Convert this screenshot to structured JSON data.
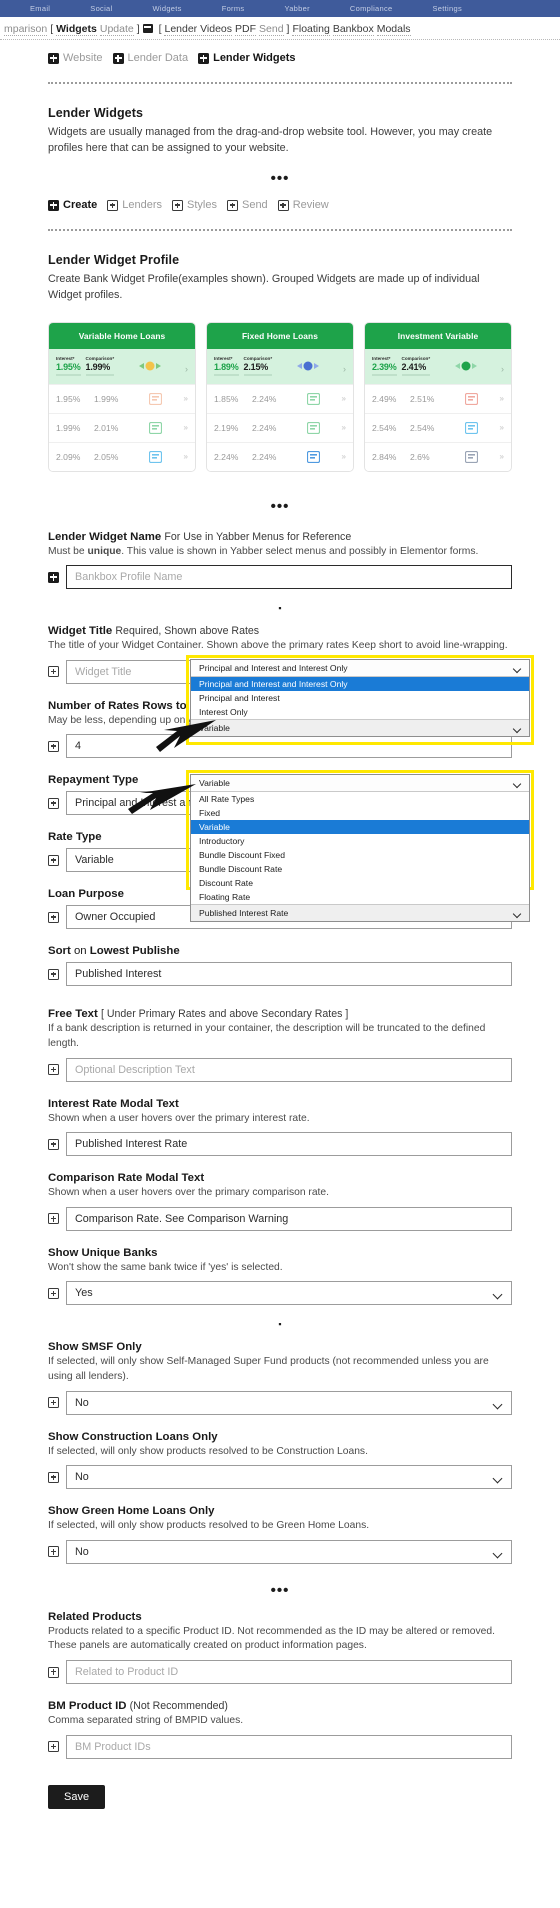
{
  "adminbar": {
    "items": [
      "Email",
      "Social",
      "Widgets",
      "Forms",
      "Yabber",
      "Compliance",
      "Settings"
    ]
  },
  "navstrip": {
    "items": [
      {
        "text": "mparison",
        "style": "dim"
      },
      {
        "text": "[",
        "style": "dark"
      },
      {
        "text": "Widgets",
        "style": "strong"
      },
      {
        "text": "Update",
        "style": "dim"
      },
      {
        "text": "]",
        "style": "dark"
      },
      {
        "text": "icon",
        "style": "icon"
      },
      {
        "text": "[",
        "style": "dark"
      },
      {
        "text": "Lender Videos",
        "style": "dark"
      },
      {
        "text": "PDF",
        "style": "dark"
      },
      {
        "text": "Send",
        "style": "dim"
      },
      {
        "text": "]",
        "style": "dark"
      },
      {
        "text": "Floating",
        "style": "dark"
      },
      {
        "text": "Bankbox",
        "style": "dark"
      },
      {
        "text": "Modals",
        "style": "dark"
      }
    ]
  },
  "breadcrumb_tabs": [
    {
      "label": "Website",
      "active": false
    },
    {
      "label": "Lender Data",
      "active": false
    },
    {
      "label": "Lender Widgets",
      "active": true
    }
  ],
  "intro": {
    "title": "Lender Widgets",
    "description": "Widgets are usually managed from the drag-and-drop website tool. However, you may create profiles here that can be assigned to your website.",
    "ellipsis": "•••"
  },
  "subtabs": [
    {
      "label": "Create",
      "active": true
    },
    {
      "label": "Lenders",
      "active": false
    },
    {
      "label": "Styles",
      "active": false
    },
    {
      "label": "Send",
      "active": false
    },
    {
      "label": "Review",
      "active": false
    }
  ],
  "profile": {
    "title": "Lender Widget Profile",
    "description": "Create Bank Widget Profile(examples shown). Grouped Widgets are made up of individual Widget profiles."
  },
  "widget_cards": [
    {
      "title": "Variable Home Loans",
      "col1_label": "Interest*",
      "col2_label": "Comparison*",
      "primary": {
        "interest": "1.95%",
        "comparison": "1.99%"
      },
      "rows": [
        {
          "interest": "1.95%",
          "comparison": "1.99%"
        },
        {
          "interest": "1.99%",
          "comparison": "2.01%"
        },
        {
          "interest": "2.09%",
          "comparison": "2.05%"
        }
      ]
    },
    {
      "title": "Fixed Home Loans",
      "col1_label": "Interest*",
      "col2_label": "Comparison*",
      "primary": {
        "interest": "1.89%",
        "comparison": "2.15%"
      },
      "rows": [
        {
          "interest": "1.85%",
          "comparison": "2.24%"
        },
        {
          "interest": "2.19%",
          "comparison": "2.24%"
        },
        {
          "interest": "2.24%",
          "comparison": "2.24%"
        }
      ]
    },
    {
      "title": "Investment Variable",
      "col1_label": "Interest*",
      "col2_label": "Comparison*",
      "primary": {
        "interest": "2.39%",
        "comparison": "2.41%"
      },
      "rows": [
        {
          "interest": "2.49%",
          "comparison": "2.51%"
        },
        {
          "interest": "2.54%",
          "comparison": "2.54%"
        },
        {
          "interest": "2.84%",
          "comparison": "2.6%"
        }
      ]
    }
  ],
  "fields": {
    "lender_widget_name": {
      "label_bold": "Lender Widget Name",
      "label_light": "For Use in Yabber Menus for Reference",
      "help_a": "Must be ",
      "help_b": "unique",
      "help_c": ". This value is shown in Yabber select menus and possibly in Elementor forms.",
      "placeholder": "Bankbox Profile Name"
    },
    "widget_title": {
      "label_bold": "Widget Title",
      "label_light": "Required, Shown above Rates",
      "help": "The title of your Widget Container. Shown above the primary rates Keep short to avoid line-wrapping.",
      "placeholder": "Widget Title"
    },
    "rates_rows": {
      "label": "Number of Rates Rows to Show",
      "help": "May be less, depending up  only a few banks are used.",
      "value": "4"
    },
    "repayment_type": {
      "label": "Repayment Type",
      "value": "Principal and Interest and Interest Only"
    },
    "rate_type": {
      "label": "Rate Type",
      "value": "Variable"
    },
    "loan_purpose": {
      "label": "Loan Purpose",
      "value": "Owner Occupied"
    },
    "sort_on": {
      "label_a": "Sort",
      "label_b": " on ",
      "label_c": "Lowest Publishe",
      "value": "Published Interest "
    },
    "free_text": {
      "label_bold": "Free Text",
      "label_light": "[ Under Primary Rates and above Secondary Rates ]",
      "help": "If a bank description is returned in your container, the description will be truncated to the defined length.",
      "placeholder": "Optional Description Text"
    },
    "interest_modal": {
      "label": "Interest Rate Modal Text",
      "help": "Shown when a user hovers over the primary interest rate.",
      "value": "Published Interest Rate"
    },
    "comparison_modal": {
      "label": "Comparison Rate Modal Text",
      "help": "Shown when a user hovers over the primary comparison rate.",
      "value": "Comparison Rate. See Comparison Warning"
    },
    "unique_banks": {
      "label": "Show Unique Banks",
      "help": "Won't show the same bank twice if 'yes' is selected.",
      "value": "Yes"
    },
    "smsf_only": {
      "label": "Show SMSF Only",
      "help": "If selected, will only show Self-Managed Super Fund products (not recommended unless you are using all lenders).",
      "value": "No"
    },
    "construction_only": {
      "label": "Show Construction Loans Only",
      "help": "If selected, will only show products resolved to be Construction Loans.",
      "value": "No"
    },
    "green_only": {
      "label": "Show Green Home Loans Only",
      "help": "If selected, will only show products resolved to be Green Home Loans.",
      "value": "No"
    },
    "related_products": {
      "label": "Related Products",
      "help": "Products related to a specific Product ID. Not recommended as the ID may be altered or removed. These panels are automatically created on product information pages.",
      "placeholder": "Related to Product ID"
    },
    "bm_product_id": {
      "label_bold": "BM Product ID",
      "label_light": "(Not Recommended)",
      "help": "Comma separated string of BMPID values.",
      "placeholder": "BM Product IDs"
    }
  },
  "open_dropdown_repayment": {
    "selected": "Principal and Interest and Interest Only",
    "options": [
      "Principal and Interest and Interest Only",
      "Principal and Interest",
      "Interest Only"
    ],
    "highlighted_index": 0,
    "footer": "Variable"
  },
  "open_dropdown_rate_type": {
    "selected": "Variable",
    "options": [
      "All Rate Types",
      "Fixed",
      "Variable",
      "Introductory",
      "Bundle Discount Fixed",
      "Bundle Discount Rate",
      "Discount Rate",
      "Floating Rate"
    ],
    "highlighted_index": 2,
    "footer": "Published Interest Rate"
  },
  "save": {
    "label": "Save"
  },
  "colors": {
    "brand_green": "#1ea34a",
    "highlight_yellow": "#ffe800",
    "select_blue": "#1a7bd6",
    "adminbar": "#3f5b9b"
  }
}
